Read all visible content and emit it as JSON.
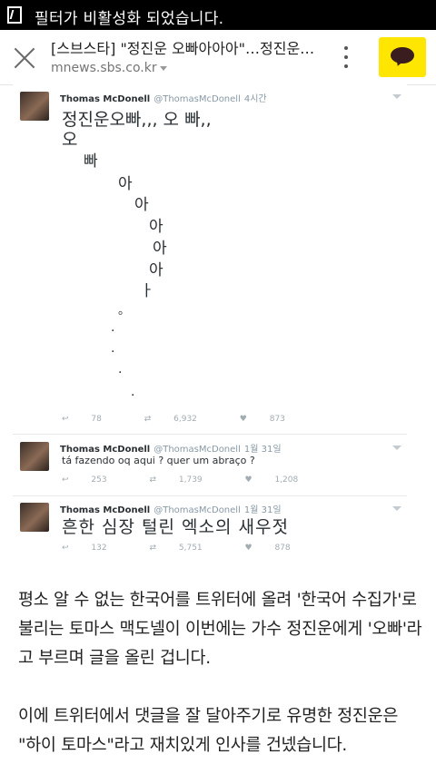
{
  "status": {
    "text": "필터가 비활성화 되었습니다."
  },
  "toolbar": {
    "title": "[스브스타] \"정진운 오빠아아아\"…정진운…",
    "url": "mnews.sbs.co.kr"
  },
  "tweets": [
    {
      "name": "Thomas McDonell",
      "handle": "@ThomasMcDonell",
      "time": "4시간",
      "line1": "정진운오빠,,, 오 빠,,",
      "cascade": [
        "오",
        "빠",
        "아",
        "아",
        "아",
        "아",
        "아",
        "ㅏ",
        "。",
        ".",
        ".",
        ".",
        "."
      ],
      "reply": "78",
      "retweets": "6,932",
      "likes": "873"
    },
    {
      "name": "Thomas McDonell",
      "handle": "@ThomasMcDonell",
      "time": "1월 31일",
      "text": "tá fazendo oq aqui ? quer um abraço ?",
      "reply": "253",
      "retweets": "1,739",
      "likes": "1,208"
    },
    {
      "name": "Thomas McDonell",
      "handle": "@ThomasMcDonell",
      "time": "1월 31일",
      "text": "흔한 심장 털린 엑소의 새우젓",
      "reply": "132",
      "retweets": "5,751",
      "likes": "878"
    }
  ],
  "article": {
    "p1": "평소 알 수 없는 한국어를 트위터에 올려 '한국어 수집가'로 불리는 토마스 맥도넬이 이번에는 가수 정진운에게 '오빠'라고 부르며 글을 올린 겁니다.",
    "p2": "이에 트위터에서 댓글을 잘 달아주기로 유명한 정진운은 \"하이 토마스\"라고 재치있게 인사를 건넸습니다."
  }
}
